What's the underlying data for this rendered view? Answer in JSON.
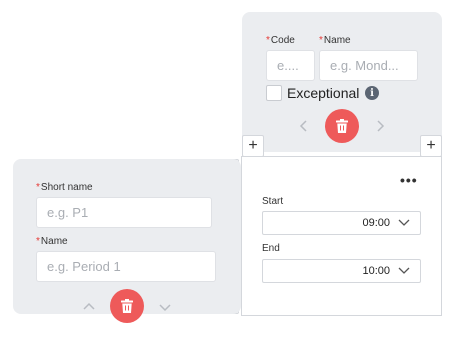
{
  "top_card": {
    "code_label": "Code",
    "code_placeholder": "e....",
    "name_label": "Name",
    "name_placeholder": "e.g. Mond...",
    "exceptional_label": "Exceptional",
    "info_glyph": "i",
    "required_mark": "*"
  },
  "period_card": {
    "short_name_label": "Short name",
    "short_name_placeholder": "e.g. P1",
    "name_label": "Name",
    "name_placeholder": "e.g. Period 1",
    "required_mark": "*"
  },
  "time_panel": {
    "menu_glyph": "•••",
    "start_label": "Start",
    "start_value": "09:00",
    "end_label": "End",
    "end_value": "10:00"
  },
  "plus_glyph": "+",
  "colors": {
    "card_bg": "#ebedf0",
    "delete_red": "#ee5a5a",
    "required_red": "#e53935"
  },
  "icons": [
    "trash-icon",
    "chevron-left-icon",
    "chevron-right-icon",
    "chevron-up-icon",
    "chevron-down-icon",
    "info-icon",
    "plus-icon",
    "more-icon"
  ]
}
